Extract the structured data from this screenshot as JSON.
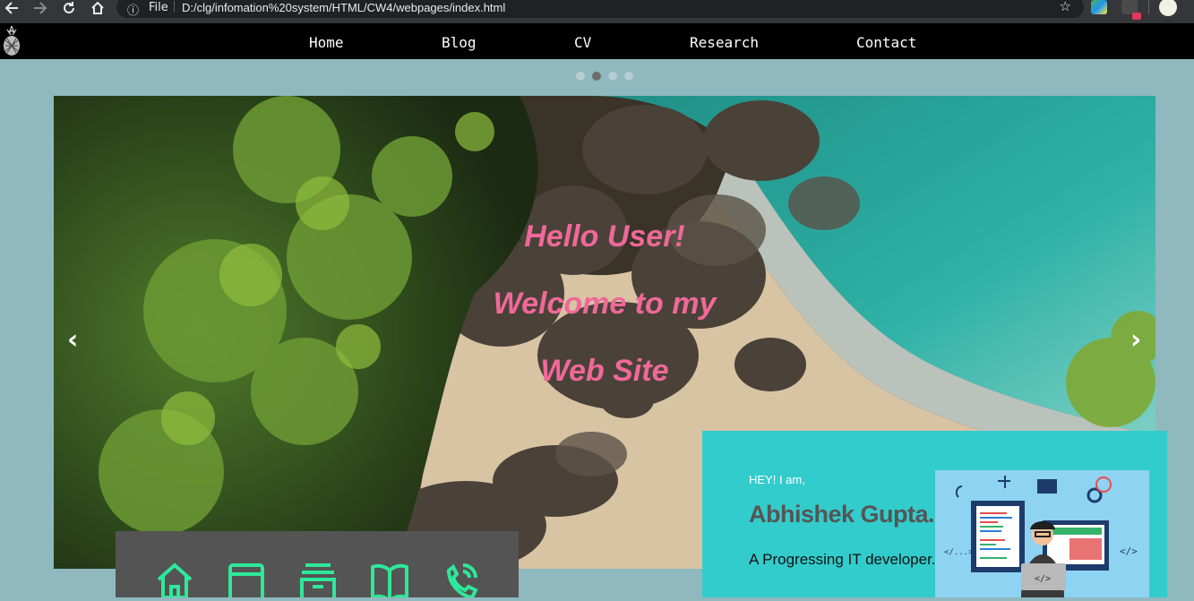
{
  "browser": {
    "back_icon": "arrow-left-icon",
    "forward_icon": "arrow-right-icon",
    "reload_icon": "reload-icon",
    "home_icon": "home-icon",
    "info_glyph": "ⓘ",
    "file_label": "File",
    "url": "D:/clg/infomation%20system/HTML/CW4/webpages/index.html"
  },
  "nav": {
    "items": [
      {
        "label": "Home"
      },
      {
        "label": "Blog"
      },
      {
        "label": "CV"
      },
      {
        "label": "Research"
      },
      {
        "label": "Contact"
      }
    ]
  },
  "carousel": {
    "slide_count": 4,
    "active_index": 1,
    "prev_glyph": "‹",
    "next_glyph": "›",
    "headline": [
      "Hello User!",
      "Welcome to my",
      "Web Site"
    ]
  },
  "quick_icons": [
    "home-icon",
    "browser-window-icon",
    "archive-icon",
    "book-icon",
    "phone-call-icon"
  ],
  "profile": {
    "greeting": "HEY! I am,",
    "name": "Abhishek Gupta.",
    "role": "A Progressing IT developer."
  },
  "colors": {
    "page_bg": "#8fb8bf",
    "headline": "#f0689a",
    "icon_accent": "#2ee89a",
    "profile_bg": "#33cccc"
  }
}
